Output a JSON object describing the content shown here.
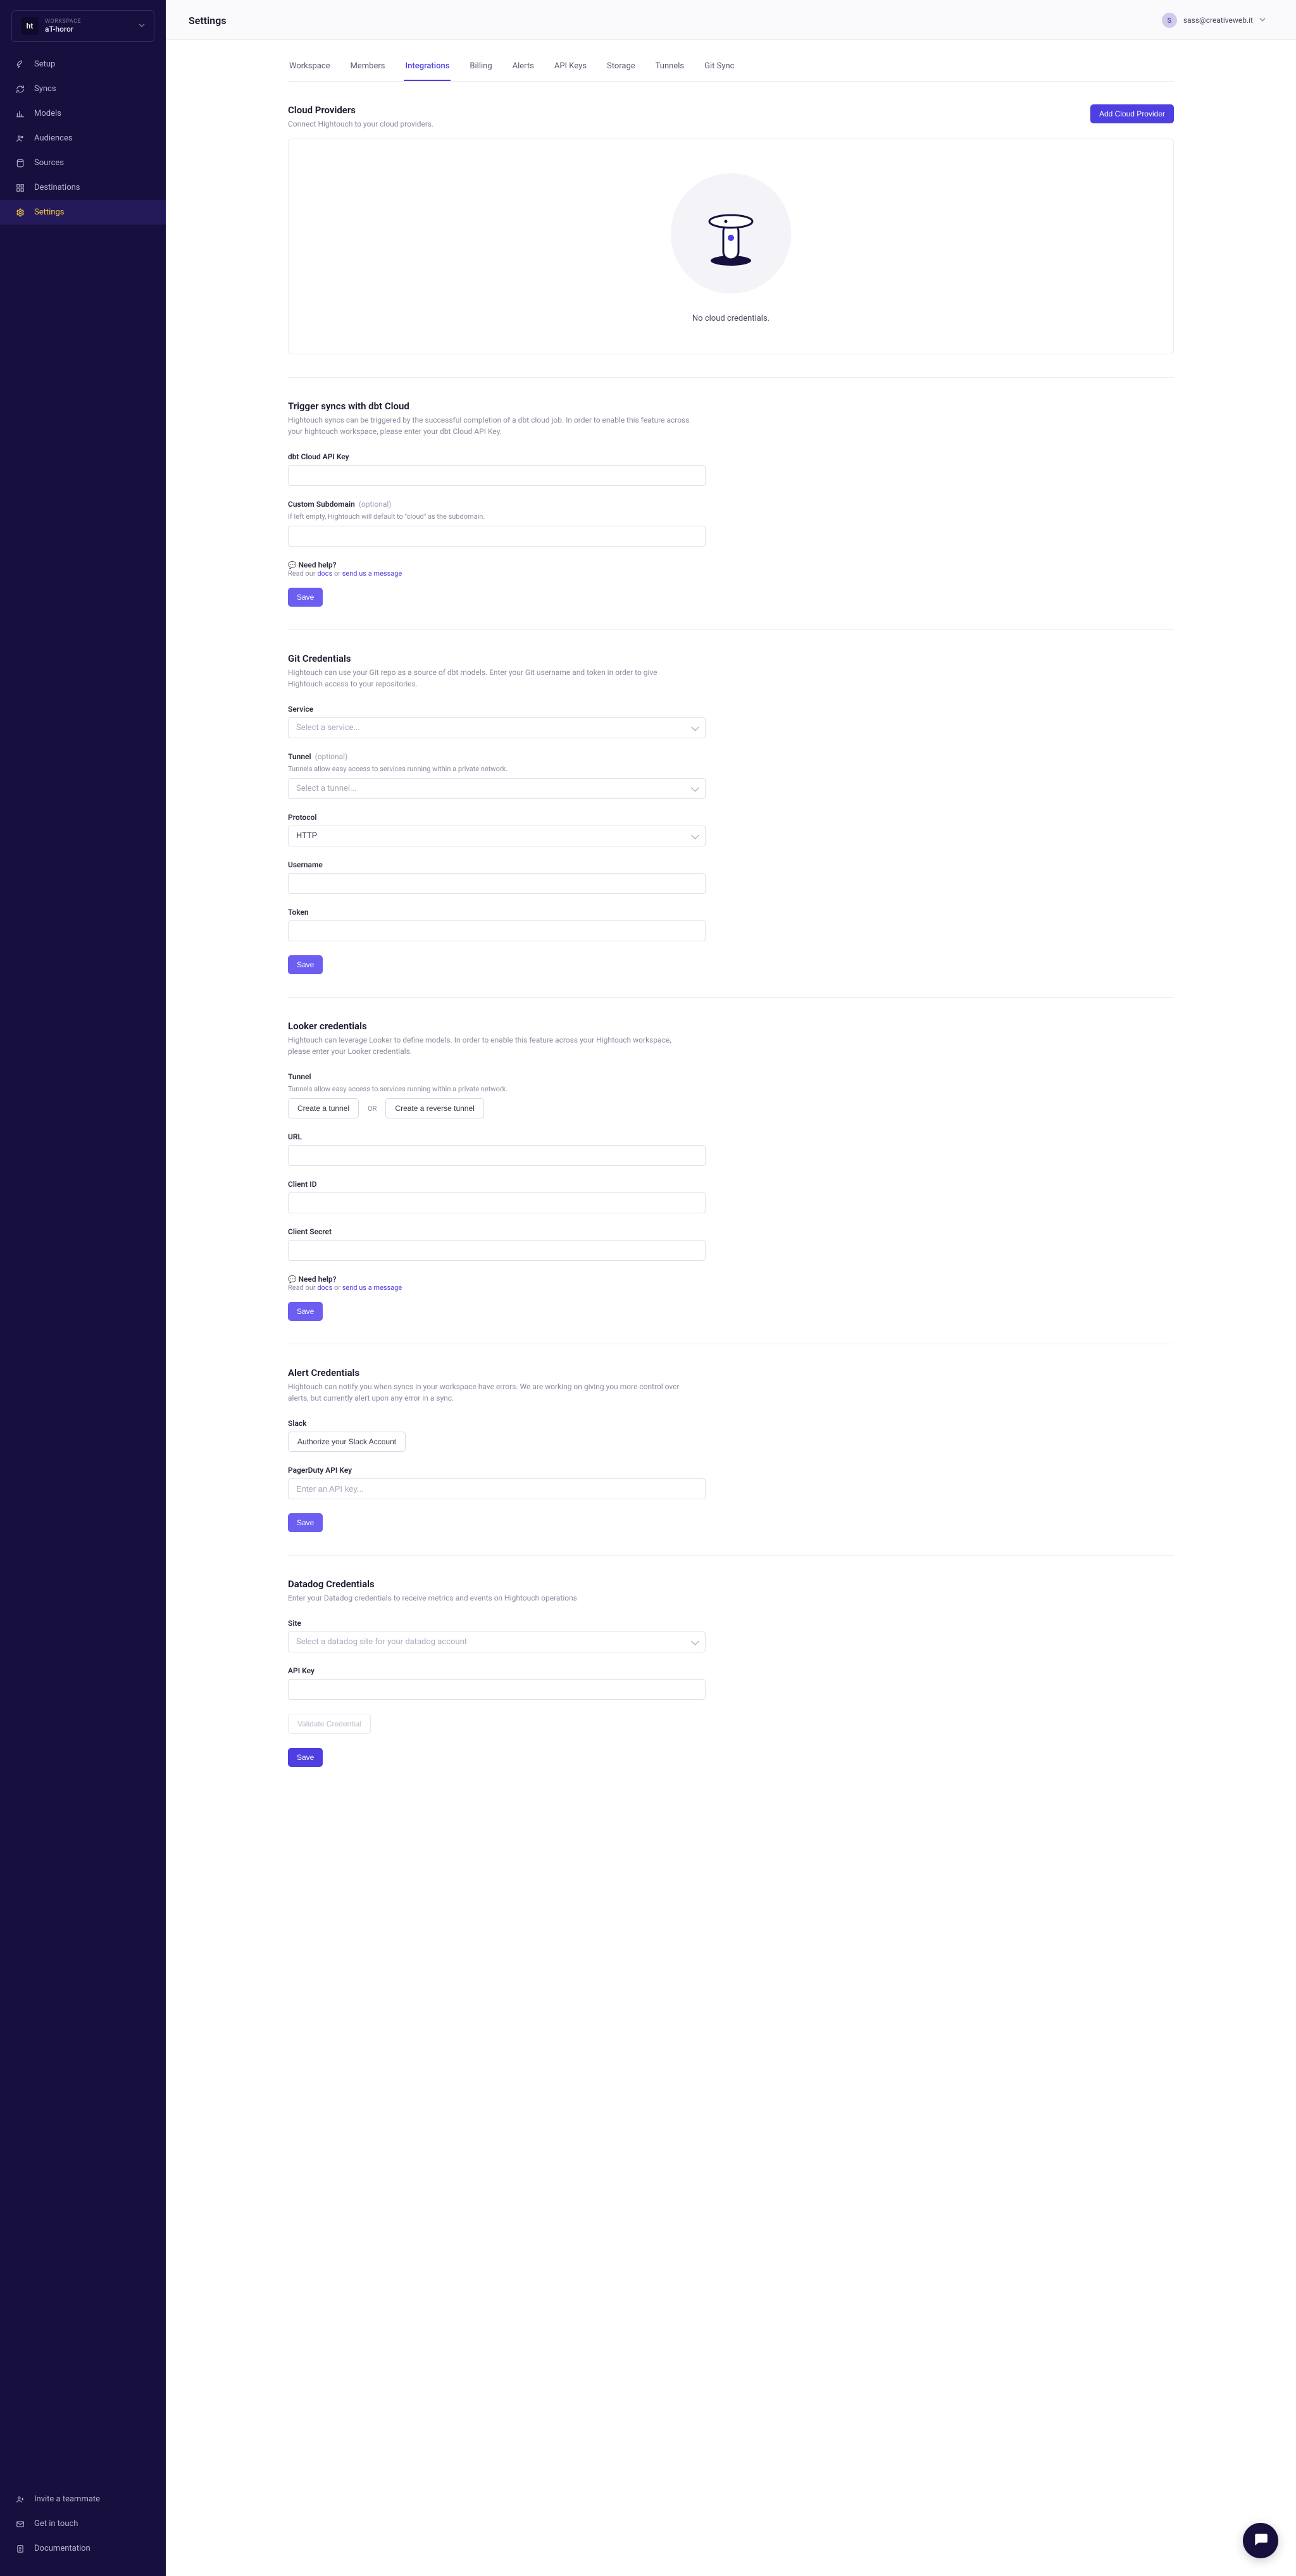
{
  "workspace": {
    "logo_text": "ht",
    "label": "WORKSPACE",
    "name": "aT-horor"
  },
  "sidebar": {
    "items": [
      {
        "label": "Setup"
      },
      {
        "label": "Syncs"
      },
      {
        "label": "Models"
      },
      {
        "label": "Audiences"
      },
      {
        "label": "Sources"
      },
      {
        "label": "Destinations"
      },
      {
        "label": "Settings"
      }
    ],
    "footer": [
      {
        "label": "Invite a teammate"
      },
      {
        "label": "Get in touch"
      },
      {
        "label": "Documentation"
      }
    ]
  },
  "header": {
    "title": "Settings",
    "user_email": "sass@creativeweb.it",
    "avatar_initial": "S"
  },
  "tabs": [
    {
      "label": "Workspace"
    },
    {
      "label": "Members"
    },
    {
      "label": "Integrations",
      "active": true
    },
    {
      "label": "Billing"
    },
    {
      "label": "Alerts"
    },
    {
      "label": "API Keys"
    },
    {
      "label": "Storage"
    },
    {
      "label": "Tunnels"
    },
    {
      "label": "Git Sync"
    }
  ],
  "cloud": {
    "title": "Cloud Providers",
    "subtitle": "Connect Hightouch to your cloud providers.",
    "add_btn": "Add Cloud Provider",
    "empty": "No cloud credentials."
  },
  "dbt": {
    "title": "Trigger syncs with dbt Cloud",
    "subtitle": "Hightouch syncs can be triggered by the successful completion of a dbt cloud job. In order to enable this feature across your hightouch workspace, please enter your dbt Cloud API Key.",
    "api_key_label": "dbt Cloud API Key",
    "subdomain_label": "Custom Subdomain",
    "optional": "(optional)",
    "subdomain_help": "If left empty, Hightouch will default to \"cloud\" as the subdomain.",
    "save": "Save"
  },
  "need_help": {
    "title": "Need help?",
    "prefix": "Read our ",
    "docs": "docs",
    "mid": " or ",
    "msg": "send us a message"
  },
  "git": {
    "title": "Git Credentials",
    "subtitle": "Hightouch can use your Git repo as a source of dbt models. Enter your Git username and token in order to give Hightouch access to your repositories.",
    "service_label": "Service",
    "service_placeholder": "Select a service...",
    "tunnel_label": "Tunnel",
    "optional": "(optional)",
    "tunnel_help": "Tunnels allow easy access to services running within a private network.",
    "tunnel_placeholder": "Select a tunnel...",
    "protocol_label": "Protocol",
    "protocol_value": "HTTP",
    "username_label": "Username",
    "token_label": "Token",
    "save": "Save"
  },
  "looker": {
    "title": "Looker credentials",
    "subtitle": "Hightouch can leverage Looker to define models. In order to enable this feature across your Hightouch workspace, please enter your Looker credentials.",
    "tunnel_label": "Tunnel",
    "tunnel_help": "Tunnels allow easy access to services running within a private network.",
    "create_tunnel": "Create a tunnel",
    "or": "OR",
    "create_reverse": "Create a reverse tunnel",
    "url_label": "URL",
    "client_id_label": "Client ID",
    "client_secret_label": "Client Secret",
    "save": "Save"
  },
  "alerts": {
    "title": "Alert Credentials",
    "subtitle": "Hightouch can notify you when syncs in your workspace have errors. We are working on giving you more control over alerts, but currently alert upon any error in a sync.",
    "slack_label": "Slack",
    "slack_btn": "Authorize your Slack Account",
    "pd_label": "PagerDuty API Key",
    "pd_placeholder": "Enter an API key...",
    "save": "Save"
  },
  "datadog": {
    "title": "Datadog Credentials",
    "subtitle": "Enter your Datadog credentials to receive metrics and events on Hightouch operations",
    "site_label": "Site",
    "site_placeholder": "Select a datadog site for your datadog account",
    "api_label": "API Key",
    "validate": "Validate Credential",
    "save": "Save"
  }
}
